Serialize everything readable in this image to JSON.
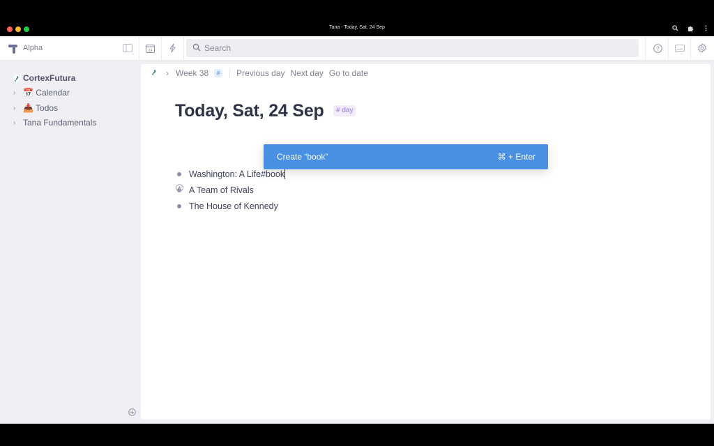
{
  "window": {
    "title": "Tana - Today, Sat, 24 Sep",
    "icons": [
      "zoom-icon",
      "extension-icon",
      "more-icon"
    ]
  },
  "header": {
    "workspace_name": "Alpha",
    "search_placeholder": "Search",
    "calendar_day": "24"
  },
  "sidebar": {
    "items": [
      {
        "label": "CortexFutura",
        "icon": "workspace-icon",
        "expandable": false
      },
      {
        "label": "📅 Calendar",
        "icon": "calendar-emoji",
        "expandable": true
      },
      {
        "label": "📥 Todos",
        "icon": "inbox-emoji",
        "expandable": true
      },
      {
        "label": "Tana Fundamentals",
        "icon": "",
        "expandable": true
      }
    ]
  },
  "breadcrumb": {
    "items": [
      "Week 38"
    ],
    "hash": "#",
    "links": [
      "Previous day",
      "Next day",
      "Go to date"
    ]
  },
  "page": {
    "title": "Today, Sat, 24 Sep",
    "tag": "# day",
    "nodes": [
      {
        "text": "Washington: A Life#book",
        "editing": true
      },
      {
        "text": "A Team of Rivals"
      },
      {
        "text": "The House of Kennedy"
      }
    ]
  },
  "popup": {
    "label": "Create “book”",
    "shortcut": "⌘ + Enter",
    "color": "#4a90e2"
  }
}
